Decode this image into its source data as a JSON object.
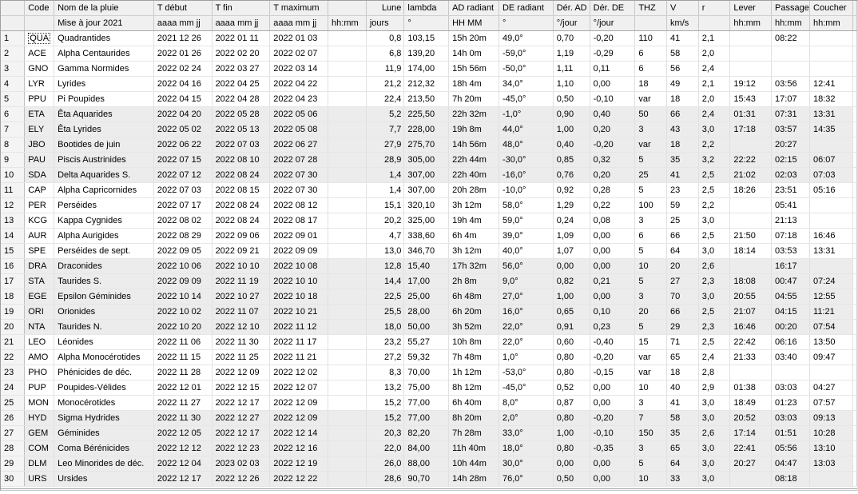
{
  "columns": [
    "Code",
    "Nom de la pluie",
    "T début",
    "T fin",
    "T maximum",
    "",
    "Lune",
    "lambda",
    "AD radiant",
    "DE radiant",
    "Dér. AD",
    "Dér. DE",
    "THZ",
    "V",
    "r",
    "Lever",
    "Passage",
    "Coucher"
  ],
  "units": [
    "",
    "Mise à jour 2021",
    "aaaa mm jj",
    "aaaa mm jj",
    "aaaa mm jj",
    "hh:mm",
    "jours",
    "°",
    "HH MM",
    "°",
    "°/jour",
    "°/jour",
    "",
    "km/s",
    "",
    "hh:mm",
    "hh:mm",
    "hh:mm"
  ],
  "rows": [
    [
      "QUA",
      "Quadrantides",
      "2021 12 26",
      "2022 01 11",
      "2022 01 03",
      "",
      "0,8",
      "103,15",
      "15h 20m",
      "49,0°",
      "0,70",
      "-0,20",
      "110",
      "41",
      "2,1",
      "",
      "08:22",
      ""
    ],
    [
      "ACE",
      "Alpha Centaurides",
      "2022 01 26",
      "2022 02 20",
      "2022 02 07",
      "",
      "6,8",
      "139,20",
      "14h 0m",
      "-59,0°",
      "1,19",
      "-0,29",
      "6",
      "58",
      "2,0",
      "",
      "",
      ""
    ],
    [
      "GNO",
      "Gamma Normides",
      "2022 02 24",
      "2022 03 27",
      "2022 03 14",
      "",
      "11,9",
      "174,00",
      "15h 56m",
      "-50,0°",
      "1,11",
      "0,11",
      "6",
      "56",
      "2,4",
      "",
      "",
      ""
    ],
    [
      "LYR",
      "Lyrides",
      "2022 04 16",
      "2022 04 25",
      "2022 04 22",
      "",
      "21,2",
      "212,32",
      "18h 4m",
      "34,0°",
      "1,10",
      "0,00",
      "18",
      "49",
      "2,1",
      "19:12",
      "03:56",
      "12:41"
    ],
    [
      "PPU",
      "Pi Poupides",
      "2022 04 15",
      "2022 04 28",
      "2022 04 23",
      "",
      "22,4",
      "213,50",
      "7h 20m",
      "-45,0°",
      "0,50",
      "-0,10",
      "var",
      "18",
      "2,0",
      "15:43",
      "17:07",
      "18:32"
    ],
    [
      "ETA",
      "Êta Aquarides",
      "2022 04 20",
      "2022 05 28",
      "2022 05 06",
      "",
      "5,2",
      "225,50",
      "22h 32m",
      "-1,0°",
      "0,90",
      "0,40",
      "50",
      "66",
      "2,4",
      "01:31",
      "07:31",
      "13:31"
    ],
    [
      "ELY",
      "Êta Lyrides",
      "2022 05 02",
      "2022 05 13",
      "2022 05 08",
      "",
      "7,7",
      "228,00",
      "19h 8m",
      "44,0°",
      "1,00",
      "0,20",
      "3",
      "43",
      "3,0",
      "17:18",
      "03:57",
      "14:35"
    ],
    [
      "JBO",
      "Bootides de juin",
      "2022 06 22",
      "2022 07 03",
      "2022 06 27",
      "",
      "27,9",
      "275,70",
      "14h 56m",
      "48,0°",
      "0,40",
      "-0,20",
      "var",
      "18",
      "2,2",
      "",
      "20:27",
      ""
    ],
    [
      "PAU",
      "Piscis Austrinides",
      "2022 07 15",
      "2022 08 10",
      "2022 07 28",
      "",
      "28,9",
      "305,00",
      "22h 44m",
      "-30,0°",
      "0,85",
      "0,32",
      "5",
      "35",
      "3,2",
      "22:22",
      "02:15",
      "06:07"
    ],
    [
      "SDA",
      "Delta Aquarides S.",
      "2022 07 12",
      "2022 08 24",
      "2022 07 30",
      "",
      "1,4",
      "307,00",
      "22h 40m",
      "-16,0°",
      "0,76",
      "0,20",
      "25",
      "41",
      "2,5",
      "21:02",
      "02:03",
      "07:03"
    ],
    [
      "CAP",
      "Alpha Capricornides",
      "2022 07 03",
      "2022 08 15",
      "2022 07 30",
      "",
      "1,4",
      "307,00",
      "20h 28m",
      "-10,0°",
      "0,92",
      "0,28",
      "5",
      "23",
      "2,5",
      "18:26",
      "23:51",
      "05:16"
    ],
    [
      "PER",
      "Perséides",
      "2022 07 17",
      "2022 08 24",
      "2022 08 12",
      "",
      "15,1",
      "320,10",
      "3h 12m",
      "58,0°",
      "1,29",
      "0,22",
      "100",
      "59",
      "2,2",
      "",
      "05:41",
      ""
    ],
    [
      "KCG",
      "Kappa Cygnides",
      "2022 08 02",
      "2022 08 24",
      "2022 08 17",
      "",
      "20,2",
      "325,00",
      "19h 4m",
      "59,0°",
      "0,24",
      "0,08",
      "3",
      "25",
      "3,0",
      "",
      "21:13",
      ""
    ],
    [
      "AUR",
      "Alpha Aurigides",
      "2022 08 29",
      "2022 09 06",
      "2022 09 01",
      "",
      "4,7",
      "338,60",
      "6h 4m",
      "39,0°",
      "1,09",
      "0,00",
      "6",
      "66",
      "2,5",
      "21:50",
      "07:18",
      "16:46"
    ],
    [
      "SPE",
      "Perséides de sept.",
      "2022 09 05",
      "2022 09 21",
      "2022 09 09",
      "",
      "13,0",
      "346,70",
      "3h 12m",
      "40,0°",
      "1,07",
      "0,00",
      "5",
      "64",
      "3,0",
      "18:14",
      "03:53",
      "13:31"
    ],
    [
      "DRA",
      "Draconides",
      "2022 10 06",
      "2022 10 10",
      "2022 10 08",
      "",
      "12,8",
      "15,40",
      "17h 32m",
      "56,0°",
      "0,00",
      "0,00",
      "10",
      "20",
      "2,6",
      "",
      "16:17",
      ""
    ],
    [
      "STA",
      "Taurides S.",
      "2022 09 09",
      "2022 11 19",
      "2022 10 10",
      "",
      "14,4",
      "17,00",
      "2h 8m",
      "9,0°",
      "0,82",
      "0,21",
      "5",
      "27",
      "2,3",
      "18:08",
      "00:47",
      "07:24"
    ],
    [
      "EGE",
      "Epsilon Géminides",
      "2022 10 14",
      "2022 10 27",
      "2022 10 18",
      "",
      "22,5",
      "25,00",
      "6h 48m",
      "27,0°",
      "1,00",
      "0,00",
      "3",
      "70",
      "3,0",
      "20:55",
      "04:55",
      "12:55"
    ],
    [
      "ORI",
      "Orionides",
      "2022 10 02",
      "2022 11 07",
      "2022 10 21",
      "",
      "25,5",
      "28,00",
      "6h 20m",
      "16,0°",
      "0,65",
      "0,10",
      "20",
      "66",
      "2,5",
      "21:07",
      "04:15",
      "11:21"
    ],
    [
      "NTA",
      "Taurides N.",
      "2022 10 20",
      "2022 12 10",
      "2022 11 12",
      "",
      "18,0",
      "50,00",
      "3h 52m",
      "22,0°",
      "0,91",
      "0,23",
      "5",
      "29",
      "2,3",
      "16:46",
      "00:20",
      "07:54"
    ],
    [
      "LEO",
      "Léonides",
      "2022 11 06",
      "2022 11 30",
      "2022 11 17",
      "",
      "23,2",
      "55,27",
      "10h 8m",
      "22,0°",
      "0,60",
      "-0,40",
      "15",
      "71",
      "2,5",
      "22:42",
      "06:16",
      "13:50"
    ],
    [
      "AMO",
      "Alpha Monocérotides",
      "2022 11 15",
      "2022 11 25",
      "2022 11 21",
      "",
      "27,2",
      "59,32",
      "7h 48m",
      "1,0°",
      "0,80",
      "-0,20",
      "var",
      "65",
      "2,4",
      "21:33",
      "03:40",
      "09:47"
    ],
    [
      "PHO",
      "Phénicides de déc.",
      "2022 11 28",
      "2022 12 09",
      "2022 12 02",
      "",
      "8,3",
      "70,00",
      "1h 12m",
      "-53,0°",
      "0,80",
      "-0,15",
      "var",
      "18",
      "2,8",
      "",
      "",
      ""
    ],
    [
      "PUP",
      "Poupides-Vélides",
      "2022 12 01",
      "2022 12 15",
      "2022 12 07",
      "",
      "13,2",
      "75,00",
      "8h 12m",
      "-45,0°",
      "0,52",
      "0,00",
      "10",
      "40",
      "2,9",
      "01:38",
      "03:03",
      "04:27"
    ],
    [
      "MON",
      "Monocérotides",
      "2022 11 27",
      "2022 12 17",
      "2022 12 09",
      "",
      "15,2",
      "77,00",
      "6h 40m",
      "8,0°",
      "0,87",
      "0,00",
      "3",
      "41",
      "3,0",
      "18:49",
      "01:23",
      "07:57"
    ],
    [
      "HYD",
      "Sigma Hydrides",
      "2022 11 30",
      "2022 12 27",
      "2022 12 09",
      "",
      "15,2",
      "77,00",
      "8h 20m",
      "2,0°",
      "0,80",
      "-0,20",
      "7",
      "58",
      "3,0",
      "20:52",
      "03:03",
      "09:13"
    ],
    [
      "GEM",
      "Géminides",
      "2022 12 05",
      "2022 12 17",
      "2022 12 14",
      "",
      "20,3",
      "82,20",
      "7h 28m",
      "33,0°",
      "1,00",
      "-0,10",
      "150",
      "35",
      "2,6",
      "17:14",
      "01:51",
      "10:28"
    ],
    [
      "COM",
      "Coma Bérénicides",
      "2022 12 12",
      "2022 12 23",
      "2022 12 16",
      "",
      "22,0",
      "84,00",
      "11h 40m",
      "18,0°",
      "0,80",
      "-0,35",
      "3",
      "65",
      "3,0",
      "22:41",
      "05:56",
      "13:10"
    ],
    [
      "DLM",
      "Leo Minorides de déc.",
      "2022 12 04",
      "2023 02 03",
      "2022 12 19",
      "",
      "26,0",
      "88,00",
      "10h 44m",
      "30,0°",
      "0,00",
      "0,00",
      "5",
      "64",
      "3,0",
      "20:27",
      "04:47",
      "13:03"
    ],
    [
      "URS",
      "Ursides",
      "2022 12 17",
      "2022 12 26",
      "2022 12 22",
      "",
      "28,6",
      "90,70",
      "14h 28m",
      "76,0°",
      "0,50",
      "0,00",
      "10",
      "33",
      "3,0",
      "",
      "08:18",
      ""
    ]
  ],
  "shaded_rows": [
    6,
    7,
    8,
    9,
    10,
    16,
    17,
    18,
    19,
    20,
    26,
    27,
    28,
    29,
    30
  ],
  "selected_cell": "QUA"
}
